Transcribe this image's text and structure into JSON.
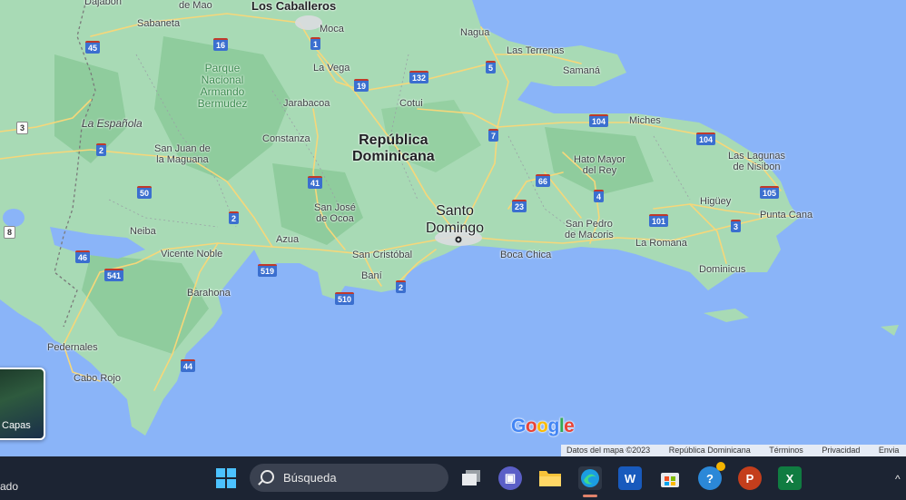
{
  "map": {
    "country_label": "República\nDominicana",
    "capital_label": "Santo\nDomingo",
    "park_label": "Parque\nNacional\nArmando\nBermudez",
    "region_label": "La Española",
    "cities": {
      "los_caballeros": "Los Caballeros",
      "dajabon": "Dajabon",
      "de_mao": "de Mao",
      "sabaneta": "Sabaneta",
      "moca": "Moca",
      "la_vega": "La Vega",
      "nagua": "Nagua",
      "las_terrenas": "Las Terrenas",
      "samana": "Samaná",
      "jarabacoa": "Jarabacoa",
      "cotui": "Cotui",
      "miches": "Miches",
      "constanza": "Constanza",
      "san_juan": "San Juan de\nla Maguana",
      "hato_mayor": "Hato Mayor\ndel Rey",
      "las_lagunas": "Las Lagunas\nde Nisibon",
      "san_jose": "San José\nde Ocoa",
      "higuey": "Higüey",
      "punta_cana": "Punta Cana",
      "neiba": "Neiba",
      "san_pedro": "San Pedro\nde Macoris",
      "azua": "Azua",
      "vicente_noble": "Vicente Noble",
      "san_cristobal": "San Cristóbal",
      "la_romana": "La Romana",
      "boca_chica": "Boca Chica",
      "bani": "Baní",
      "dominicus": "Dominicus",
      "barahona": "Barahona",
      "pedernales": "Pedernales",
      "cabo_rojo": "Cabo Rojo"
    },
    "shields": {
      "s45": "45",
      "s16": "16",
      "s1": "1",
      "s19": "19",
      "s132": "132",
      "s5": "5",
      "s3": "3",
      "s2a": "2",
      "s104a": "104",
      "s104b": "104",
      "s7": "7",
      "s66": "66",
      "s50": "50",
      "s41": "41",
      "s23": "23",
      "s4": "4",
      "s105": "105",
      "s2b": "2",
      "s101": "101",
      "s3b": "3",
      "s8": "8",
      "s46": "46",
      "s541": "541",
      "s519": "519",
      "s510": "510",
      "s2c": "2",
      "s44": "44"
    },
    "layers_button": "Capas",
    "google_logo": "Google",
    "attribution": [
      "Datos del mapa ©2023",
      "República Dominicana",
      "Términos",
      "Privacidad",
      "Envia"
    ]
  },
  "taskbar": {
    "left_status": "ado",
    "search_placeholder": "Búsqueda",
    "apps": [
      {
        "name": "Windows",
        "glyph": "⊞"
      },
      {
        "name": "Task View",
        "glyph": "❐"
      },
      {
        "name": "Teams",
        "glyph": "T"
      },
      {
        "name": "File Explorer",
        "glyph": "▬"
      },
      {
        "name": "Edge",
        "glyph": "e"
      },
      {
        "name": "Word",
        "glyph": "W"
      },
      {
        "name": "Store",
        "glyph": "▦"
      },
      {
        "name": "Help",
        "glyph": "?"
      },
      {
        "name": "PowerPoint",
        "glyph": "P"
      },
      {
        "name": "Excel",
        "glyph": "X"
      }
    ]
  },
  "colors": {
    "water": "#8ab4f8",
    "land": "#a8dab5",
    "forest": "#8fcc9d",
    "road": "#f6d77a",
    "taskbar": "#1c2433"
  }
}
